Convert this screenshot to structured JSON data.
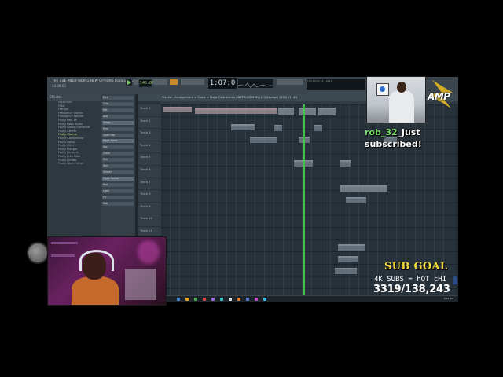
{
  "window": {
    "title": "THE CUE AND FINDING NEW OPTIONS FOOLS HELP",
    "subtitle": "14.06.03",
    "tempo": "145.000",
    "time": "1:07:0",
    "hint": "FL STUDIO 20 | 2021"
  },
  "browser": {
    "header": "Effects",
    "items": [
      {
        "label": "Distortion",
        "selected": false
      },
      {
        "label": "Filter",
        "selected": false
      },
      {
        "label": "Flanger",
        "selected": false
      },
      {
        "label": "Frequency Shifter",
        "selected": false
      },
      {
        "label": "Frequency Splitter",
        "selected": false
      },
      {
        "label": "Fruity Fast LP",
        "selected": false
      },
      {
        "label": "Fruity Bass Boost",
        "selected": false
      },
      {
        "label": "Fruity Blood Overdrive",
        "selected": false
      },
      {
        "label": "Fruity Center",
        "selected": false
      },
      {
        "label": "Fruity Chorus",
        "selected": true
      },
      {
        "label": "Fruity Compressor",
        "selected": false
      },
      {
        "label": "Fruity Delay",
        "selected": false
      },
      {
        "label": "Fruity Filter",
        "selected": false
      },
      {
        "label": "Fruity Flanger",
        "selected": false
      },
      {
        "label": "Fruity Formula",
        "selected": false
      },
      {
        "label": "Fruity Free Filter",
        "selected": false
      },
      {
        "label": "Fruity Limiter",
        "selected": false
      },
      {
        "label": "Fruity Love Philter",
        "selected": false
      }
    ]
  },
  "rack": {
    "channels": [
      {
        "label": "Kick",
        "highlight": false
      },
      {
        "label": "Clap",
        "highlight": false
      },
      {
        "label": "Hat",
        "highlight": false
      },
      {
        "label": "808",
        "highlight": false
      },
      {
        "label": "Snare",
        "highlight": true
      },
      {
        "label": "Perc",
        "highlight": false
      },
      {
        "label": "Open Hat",
        "highlight": false
      },
      {
        "label": "Major Bassl",
        "highlight": true
      },
      {
        "label": "Vox",
        "highlight": false
      },
      {
        "label": "Crash",
        "highlight": false
      },
      {
        "label": "Rim",
        "highlight": false
      },
      {
        "label": "Tom",
        "highlight": false
      },
      {
        "label": "Shaker",
        "highlight": false
      },
      {
        "label": "Major Sound",
        "highlight": true
      },
      {
        "label": "Pad",
        "highlight": false
      },
      {
        "label": "Lead",
        "highlight": false
      },
      {
        "label": "FX",
        "highlight": false
      },
      {
        "label": "Sub",
        "highlight": false
      }
    ]
  },
  "playlist": {
    "header": "Playlist - Arrangement > Snare > Major Distribution (INSTRUMENTAL) (22 Savage) 126 (i)(1) #1",
    "tracks": [
      "Track 1",
      "Track 2",
      "Track 3",
      "Track 4",
      "Track 5",
      "Track 6",
      "Track 7",
      "Track 8",
      "Track 9",
      "Track 10",
      "Track 11",
      "Track 12",
      "Track 13",
      "Track 14",
      "Track 15",
      "Track 16"
    ]
  },
  "taskbar": {
    "clock": "9:21 AM",
    "icon_colors": [
      "#3d8bd8",
      "#e1a32a",
      "#4cb050",
      "#d84848",
      "#9a6bd8",
      "#3ac0c0",
      "#e0e0e0",
      "#d8803a",
      "#5a7bd8",
      "#c04ac0",
      "#42b8e0"
    ]
  },
  "overlay": {
    "logo": "AMP",
    "alert": {
      "username": "rob_32",
      "rest_line1": "_just",
      "line2": "subscribed!"
    },
    "sub_goal": {
      "title": "SUB GOAL",
      "description": "4K SUBS = hOT cHI",
      "count": "3319/138,243",
      "progress": 0.024
    }
  },
  "colors": {
    "accent_green": "#43c24a",
    "sub_goal_title": "#f2d93d",
    "alert_user": "#7be06b"
  }
}
